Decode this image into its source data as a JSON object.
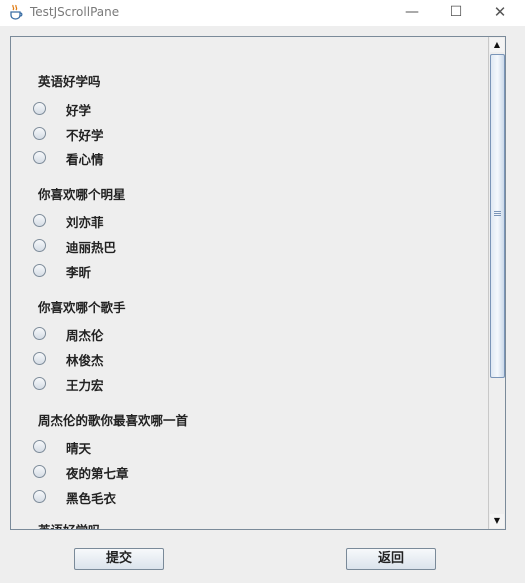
{
  "window": {
    "title": "TestJScrollPane",
    "minimize_icon": "minimize-icon",
    "maximize_icon": "maximize-icon",
    "close_icon": "close-icon",
    "app_icon": "java-coffee-cup-icon"
  },
  "questions": [
    {
      "title": "英语好学吗",
      "options": [
        "好学",
        "不好学",
        "看心情"
      ]
    },
    {
      "title": "你喜欢哪个明星",
      "options": [
        "刘亦菲",
        "迪丽热巴",
        "李昕"
      ]
    },
    {
      "title": "你喜欢哪个歌手",
      "options": [
        "周杰伦",
        "林俊杰",
        "王力宏"
      ]
    },
    {
      "title": "周杰伦的歌你最喜欢哪一首",
      "options": [
        "晴天",
        "夜的第七章",
        "黑色毛衣"
      ]
    },
    {
      "title": "英语好学吗",
      "options": []
    }
  ],
  "buttons": {
    "submit": "提交",
    "back": "返回"
  }
}
